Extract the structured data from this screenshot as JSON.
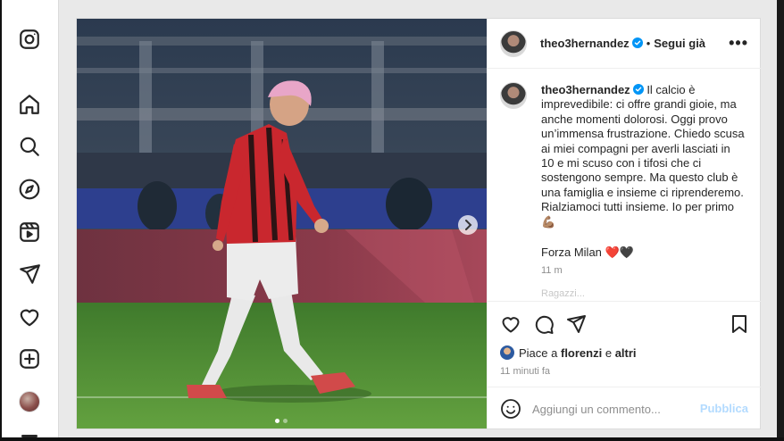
{
  "sidebar": {
    "items": [
      {
        "name": "instagram-icon"
      },
      {
        "name": "home-icon"
      },
      {
        "name": "search-icon"
      },
      {
        "name": "explore-icon"
      },
      {
        "name": "reels-icon"
      },
      {
        "name": "messages-icon"
      },
      {
        "name": "notifications-icon"
      },
      {
        "name": "create-icon"
      },
      {
        "name": "profile-avatar"
      }
    ]
  },
  "post": {
    "author": "theo3hernandez",
    "separator": "•",
    "follow_label": "Segui già",
    "more_label": "•••",
    "caption": "Il calcio è imprevedibile: ci offre grandi gioie, ma anche momenti dolorosi. Oggi provo un’immensa frustrazione. Chiedo scusa ai miei compagni per averli lasciati in 10 e mi scuso con i tifosi che ci sostengono sempre. Ma questo club è una famiglia e insieme ci riprenderemo. Rialziamoci tutti insieme. Io per primo💪🏽",
    "caption_second": "Forza Milan ❤️🖤",
    "caption_time": "11 m",
    "faded_text": "Ragazzi...",
    "likes_prefix": "Piace a ",
    "likes_user": "florenzi",
    "likes_mid": " e ",
    "likes_rest": "altri",
    "time_ago": "11 minuti fa",
    "comment_placeholder": "Aggiungi un commento...",
    "publish_label": "Pubblica",
    "carousel_index": 1,
    "carousel_total": 2
  },
  "colors": {
    "accent": "#0095f6",
    "publish_disabled": "#b3dbff",
    "heart": "#ed4956"
  }
}
